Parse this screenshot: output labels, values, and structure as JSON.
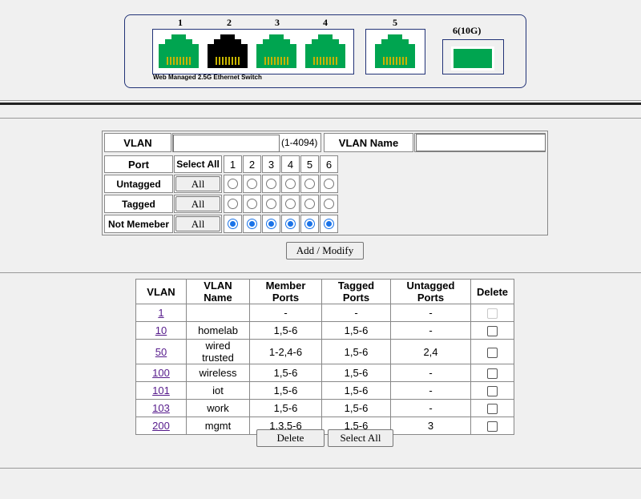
{
  "panel": {
    "label": "Web Managed 2.5G Ethernet Switch",
    "ports": [
      {
        "num": "1",
        "state": "up",
        "color": "#00a550"
      },
      {
        "num": "2",
        "state": "down",
        "color": "#000000"
      },
      {
        "num": "3",
        "state": "up",
        "color": "#00a550"
      },
      {
        "num": "4",
        "state": "up",
        "color": "#00a550"
      },
      {
        "num": "5",
        "state": "up",
        "color": "#00a550"
      }
    ],
    "sfp": {
      "num": "6(10G)",
      "color": "#00a550"
    }
  },
  "config": {
    "vlan_label": "VLAN",
    "vlan_value": "",
    "vlan_range": "(1-4094)",
    "vlan_name_label": "VLAN Name",
    "vlan_name_value": "",
    "port_label": "Port",
    "select_all_label": "Select All",
    "port_headers": [
      "1",
      "2",
      "3",
      "4",
      "5",
      "6"
    ],
    "rows": [
      {
        "label": "Untagged",
        "button": "All",
        "checked": [
          false,
          false,
          false,
          false,
          false,
          false
        ]
      },
      {
        "label": "Tagged",
        "button": "All",
        "checked": [
          false,
          false,
          false,
          false,
          false,
          false
        ]
      },
      {
        "label": "Not Memeber",
        "button": "All",
        "checked": [
          true,
          true,
          true,
          true,
          true,
          true
        ]
      }
    ],
    "add_modify_label": "Add / Modify"
  },
  "vlan_table": {
    "headers": [
      "VLAN",
      "VLAN Name",
      "Member Ports",
      "Tagged Ports",
      "Untagged Ports",
      "Delete"
    ],
    "rows": [
      {
        "vlan": "1",
        "name": "",
        "member": "-",
        "tagged": "-",
        "untagged": "-",
        "deletable": false
      },
      {
        "vlan": "10",
        "name": "homelab",
        "member": "1,5-6",
        "tagged": "1,5-6",
        "untagged": "-",
        "deletable": true
      },
      {
        "vlan": "50",
        "name": "wired trusted",
        "member": "1-2,4-6",
        "tagged": "1,5-6",
        "untagged": "2,4",
        "deletable": true
      },
      {
        "vlan": "100",
        "name": "wireless",
        "member": "1,5-6",
        "tagged": "1,5-6",
        "untagged": "-",
        "deletable": true
      },
      {
        "vlan": "101",
        "name": "iot",
        "member": "1,5-6",
        "tagged": "1,5-6",
        "untagged": "-",
        "deletable": true
      },
      {
        "vlan": "103",
        "name": "work",
        "member": "1,5-6",
        "tagged": "1,5-6",
        "untagged": "-",
        "deletable": true
      },
      {
        "vlan": "200",
        "name": "mgmt",
        "member": "1,3,5-6",
        "tagged": "1,5-6",
        "untagged": "3",
        "deletable": true
      }
    ],
    "delete_label": "Delete",
    "select_all_label": "Select All"
  }
}
